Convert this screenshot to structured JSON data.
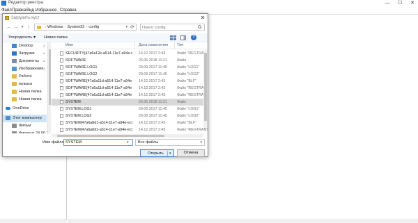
{
  "registry_window": {
    "title": "Редактор реестра",
    "menu": [
      "Файл",
      "Правка",
      "Вид",
      "Избранное",
      "Справка"
    ],
    "controls": {
      "minimize": "—",
      "maximize": "☐",
      "close": "✕"
    }
  },
  "dialog": {
    "title": "Загрузить куст",
    "close": "✕",
    "nav": {
      "back": "←",
      "forward": "→",
      "up": "↑",
      "dropdown": "▾",
      "refresh": "⟳"
    },
    "path": [
      "Windows",
      "System32",
      "config"
    ],
    "path_separator": "›",
    "search_placeholder": "Поиск: config",
    "toolbar": {
      "organize": "Упорядочить ▾",
      "new_folder": "Новая папка",
      "help": "?"
    },
    "sidebar": [
      {
        "label": "Desktop",
        "icon": "desktop-icon",
        "pinned": true
      },
      {
        "label": "Загрузки",
        "icon": "downloads-icon",
        "pinned": true
      },
      {
        "label": "Документы",
        "icon": "documents-icon",
        "pinned": true
      },
      {
        "label": "Изображения",
        "icon": "pictures-icon",
        "pinned": true
      },
      {
        "label": "Работа",
        "icon": "folder-icon",
        "pinned": false
      },
      {
        "label": "музыка",
        "icon": "folder-icon",
        "pinned": false
      },
      {
        "label": "Новая папка",
        "icon": "folder-icon",
        "pinned": false
      },
      {
        "label": "Новая папка",
        "icon": "folder-icon",
        "pinned": false
      },
      {
        "label": "OneDrive",
        "icon": "onedrive-icon",
        "pinned": false
      },
      {
        "label": "Этот компьютер",
        "icon": "this-pc-icon",
        "pinned": false,
        "selected": true
      },
      {
        "label": "Фильм",
        "icon": "drive-icon",
        "pinned": false
      },
      {
        "label": "Фиолент 24.06.2",
        "icon": "drive-icon",
        "pinned": false
      }
    ],
    "pin_glyph": "⊿",
    "columns": {
      "name": "Имя",
      "date": "Дата изменения",
      "type": "Тип"
    },
    "files": [
      {
        "name": "SECURITY{47a6a12e-a514-11e7-a94e-ec0...",
        "date": "14.12.2017 2:43",
        "type": "Файл \"REGTRANS-MS\""
      },
      {
        "name": "SOFTWARE",
        "date": "26.06.2018 11:21",
        "type": "Файл"
      },
      {
        "name": "SOFTWARE.LOG1",
        "date": "29.09.2017 11:45",
        "type": "Файл \"LOG1\""
      },
      {
        "name": "SOFTWARE.LOG2",
        "date": "29.09.2017 11:45",
        "type": "Файл \"LOG2\""
      },
      {
        "name": "SOFTWARE{47a6a11d-a514-11e7-a94e-ec0...",
        "date": "14.12.2017 2:43",
        "type": "Файл \"BLF\""
      },
      {
        "name": "SOFTWARE{47a6a11d-a514-11e7-a94e-ec0...",
        "date": "14.12.2017 2:43",
        "type": "Файл \"REGTRANS-MS\""
      },
      {
        "name": "SOFTWARE{47a6a11d-a514-11e7-a94e-ec0...",
        "date": "14.12.2017 2:43",
        "type": "Файл \"REGTRANS-MS\""
      },
      {
        "name": "SYSTEM",
        "date": "26.06.2018 11:21",
        "type": "Файл",
        "selected": true
      },
      {
        "name": "SYSTEM.LOG1",
        "date": "29.09.2017 11:45",
        "type": "Файл \"LOG1\""
      },
      {
        "name": "SYSTEM.LOG2",
        "date": "29.09.2017 11:45",
        "type": "Файл \"LOG2\""
      },
      {
        "name": "SYSTEM{47a6a0d1-a514-11e7-a94e-ec0d...",
        "date": "14.12.2017 2:43",
        "type": "Файл \"BLF\""
      },
      {
        "name": "SYSTEM{47a6a0d1-a514-11e7-a94e-ec0d...",
        "date": "14.12.2017 2:43",
        "type": "Файл \"REGTRANS-MS\""
      }
    ],
    "filename_label": "Имя файла:",
    "filename_value": "SYSTEM",
    "filetype": "Все файлы",
    "open_label": "Открыть",
    "cancel_label": "Отмена",
    "dropdown_glyph": "▾"
  },
  "colors": {
    "selection": "#cde4f7",
    "file_selected": "#d9d9d9",
    "accent": "#2d6bc7"
  }
}
